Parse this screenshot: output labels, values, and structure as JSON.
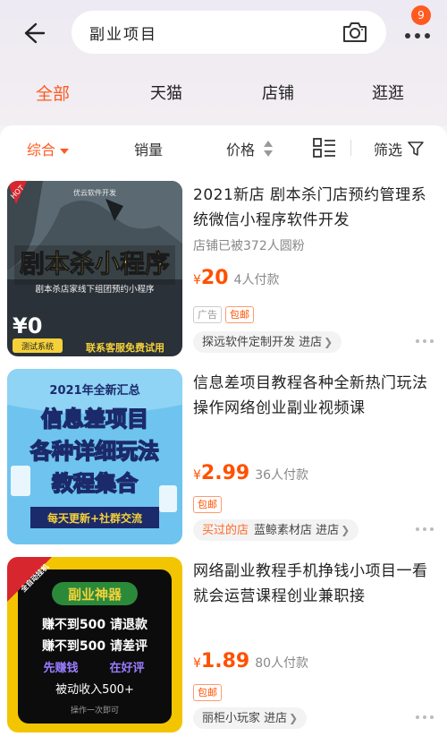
{
  "search": {
    "query": "副业项目",
    "badge_count": "9"
  },
  "tabs": [
    {
      "label": "全部",
      "active": true
    },
    {
      "label": "天猫"
    },
    {
      "label": "店铺"
    },
    {
      "label": "逛逛"
    }
  ],
  "sort": {
    "general": "综合",
    "sales": "销量",
    "price": "价格",
    "filter": "筛选"
  },
  "products": [
    {
      "title": "2021新店 剧本杀门店预约管理系统微信小程序软件开发",
      "subinfo": "店铺已被372人圆粉",
      "price_symbol": "¥",
      "price": "20",
      "sold": "4人付款",
      "tags": [
        "广告",
        "包邮"
      ],
      "shop": "探远软件定制开发",
      "shop_link": "进店",
      "thumb": {
        "hot": "HOT",
        "brand": "优云软件开发",
        "headline": "剧本杀小程序",
        "sub": "剧本杀店家线下组团预约小程序",
        "price": "¥0",
        "tag": "测试系统",
        "footer": "联系客服免费试用"
      }
    },
    {
      "title": "信息差项目教程各种全新热门玩法操作网络创业副业视频课",
      "price_symbol": "¥",
      "price": "2.99",
      "sold": "36人付款",
      "tags": [
        "包邮"
      ],
      "bought": "买过的店",
      "shop": "蓝鲸素材店",
      "shop_link": "进店",
      "thumb": {
        "top": "2021年全新汇总",
        "line1": "信息差项目",
        "line2": "各种详细玩法",
        "line3": "教程集合",
        "footer": "每天更新+社群交流"
      }
    },
    {
      "title": "网络副业教程手机挣钱小项目一看就会运营课程创业兼职接",
      "price_symbol": "¥",
      "price": "1.89",
      "sold": "80人付款",
      "tags": [
        "包邮"
      ],
      "shop": "丽柜小玩家",
      "shop_link": "进店",
      "thumb": {
        "corner": "全自动挂机",
        "title": "副业神器",
        "l1": "赚不到500 请退款",
        "l2": "赚不到500 请差评",
        "l3a": "先赚钱",
        "l3b": "在好评",
        "l4": "被动收入500+",
        "l5": "操作一次即可"
      }
    }
  ],
  "colors": {
    "accent": "#ff5a1f",
    "price": "#ff5000"
  }
}
